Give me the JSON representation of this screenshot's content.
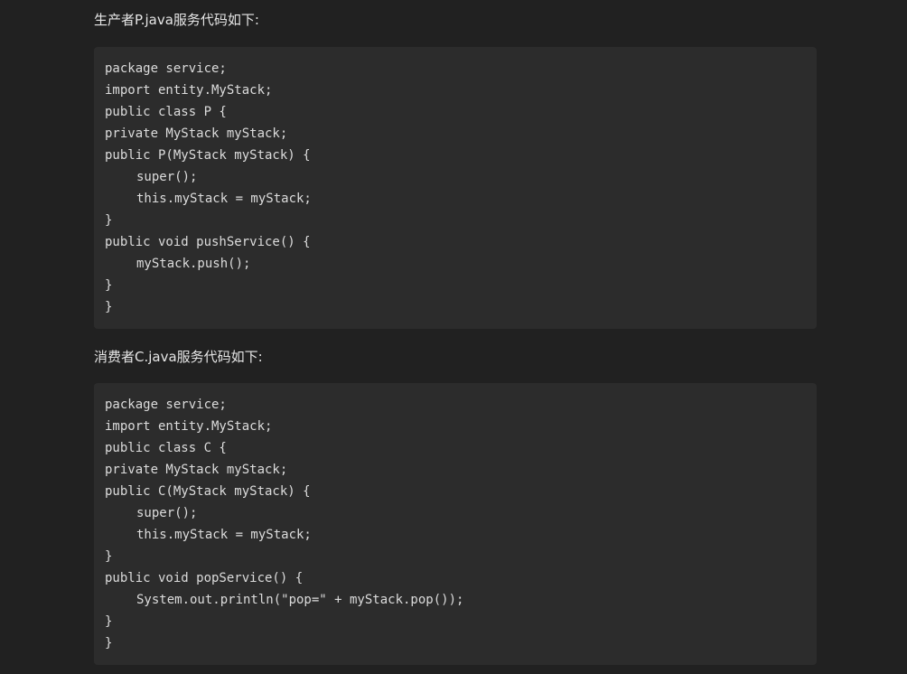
{
  "paragraphs": {
    "producer_intro": "生产者P.java服务代码如下:",
    "consumer_intro": "消费者C.java服务代码如下:"
  },
  "producer_code": [
    {
      "text": "package service;",
      "indent": false
    },
    {
      "text": "import entity.MyStack;",
      "indent": false
    },
    {
      "text": "public class P {",
      "indent": false
    },
    {
      "text": "private MyStack myStack;",
      "indent": false
    },
    {
      "text": "public P(MyStack myStack) {",
      "indent": false
    },
    {
      "text": "super();",
      "indent": true
    },
    {
      "text": "this.myStack = myStack;",
      "indent": true
    },
    {
      "text": "}",
      "indent": false
    },
    {
      "text": "public void pushService() {",
      "indent": false
    },
    {
      "text": "myStack.push();",
      "indent": true
    },
    {
      "text": "}",
      "indent": false
    },
    {
      "text": "}",
      "indent": false
    }
  ],
  "consumer_code": [
    {
      "text": "package service;",
      "indent": false
    },
    {
      "text": "import entity.MyStack;",
      "indent": false
    },
    {
      "text": "public class C {",
      "indent": false
    },
    {
      "text": "private MyStack myStack;",
      "indent": false
    },
    {
      "text": "public C(MyStack myStack) {",
      "indent": false
    },
    {
      "text": "super();",
      "indent": true
    },
    {
      "text": "this.myStack = myStack;",
      "indent": true
    },
    {
      "text": "}",
      "indent": false
    },
    {
      "text": "public void popService() {",
      "indent": false
    },
    {
      "text": "System.out.println(\"pop=\" + myStack.pop());",
      "indent": true
    },
    {
      "text": "}",
      "indent": false
    },
    {
      "text": "}",
      "indent": false
    }
  ],
  "colors": {
    "page_background": "#212121",
    "code_background": "#2c2c2c",
    "text": "#e6e6e6",
    "code_text": "#dcdcdc"
  }
}
